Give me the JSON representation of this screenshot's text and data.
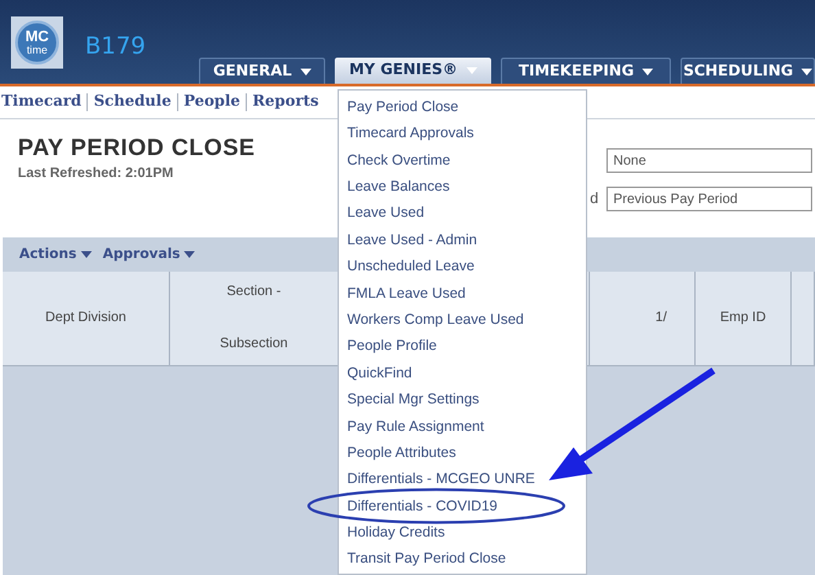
{
  "header": {
    "logo_top": "MC",
    "logo_bottom": "time",
    "site": "B179"
  },
  "nav_tabs": [
    {
      "label": "GENERAL",
      "selected": false
    },
    {
      "label": "MY GENIES®",
      "selected": true
    },
    {
      "label": "TIMEKEEPING",
      "selected": false
    },
    {
      "label": "SCHEDULING",
      "selected": false
    }
  ],
  "sub_links": [
    "Timecard",
    "Schedule",
    "People",
    "Reports"
  ],
  "page": {
    "title": "PAY PERIOD CLOSE",
    "refreshed": "Last Refreshed: 2:01PM"
  },
  "filters": [
    {
      "value": "None"
    },
    {
      "label": "d",
      "value": "Previous Pay Period"
    }
  ],
  "toolbar": [
    "Actions",
    "Approvals"
  ],
  "table": {
    "columns": [
      "Dept Division",
      "Section - Subsection",
      "",
      "1/",
      "Emp ID",
      ""
    ]
  },
  "menu": {
    "items": [
      {
        "label": "Pay Period Close",
        "circled": false
      },
      {
        "label": "Timecard Approvals",
        "circled": false
      },
      {
        "label": "Check Overtime",
        "circled": false
      },
      {
        "label": "Leave Balances",
        "circled": false
      },
      {
        "label": "Leave Used",
        "circled": false
      },
      {
        "label": "Leave Used - Admin",
        "circled": false
      },
      {
        "label": "Unscheduled Leave",
        "circled": false
      },
      {
        "label": "FMLA Leave Used",
        "circled": false
      },
      {
        "label": "Workers Comp Leave Used",
        "circled": false
      },
      {
        "label": "People Profile",
        "circled": false
      },
      {
        "label": "QuickFind",
        "circled": false
      },
      {
        "label": "Special Mgr Settings",
        "circled": false
      },
      {
        "label": "Pay Rule Assignment",
        "circled": false
      },
      {
        "label": "People Attributes",
        "circled": false
      },
      {
        "label": "Differentials - MCGEO UNRE",
        "circled": false
      },
      {
        "label": "Differentials - COVID19",
        "circled": true
      },
      {
        "label": "Holiday Credits",
        "circled": false
      },
      {
        "label": "Transit Pay Period Close",
        "circled": false
      }
    ]
  }
}
